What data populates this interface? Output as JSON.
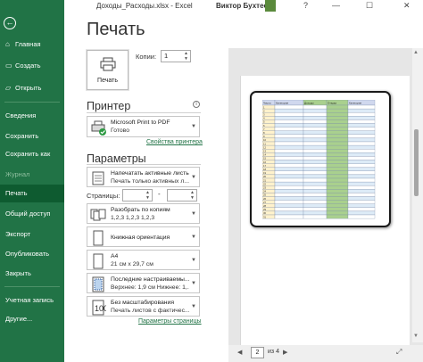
{
  "titlebar": {
    "doc_name": "Доходы_Расходы.xlsx  -  Excel",
    "user_name": "Виктор Бухтеев",
    "minimize": "—",
    "maximize": "☐",
    "close": "✕",
    "help": "?"
  },
  "sidebar": {
    "back_icon": "←",
    "items": [
      {
        "label": "Главная",
        "icon": "⌂"
      },
      {
        "label": "Создать",
        "icon": "▭"
      },
      {
        "label": "Открыть",
        "icon": "▱"
      },
      {
        "label": "Сведения"
      },
      {
        "label": "Сохранить"
      },
      {
        "label": "Сохранить как"
      },
      {
        "label": "Журнал"
      },
      {
        "label": "Печать"
      },
      {
        "label": "Общий доступ"
      },
      {
        "label": "Экспорт"
      },
      {
        "label": "Опубликовать"
      },
      {
        "label": "Закрыть"
      },
      {
        "label": "Учетная запись"
      },
      {
        "label": "Другие..."
      }
    ],
    "active_index": 7,
    "disabled_index": 6
  },
  "main": {
    "heading": "Печать",
    "print_button_label": "Печать",
    "copies_label": "Копии:",
    "copies_value": "1",
    "printer_title": "Принтер",
    "printer_name": "Microsoft Print to PDF",
    "printer_status": "Готово",
    "printer_properties_link": "Свойства принтера",
    "params_title": "Параметры",
    "settings": [
      {
        "l1": "Напечатать активные листы",
        "l2": "Печать только активных л..."
      },
      {
        "l1": "Разобрать по копиям",
        "l2": "1,2,3     1,2,3     1,2,3"
      },
      {
        "l1": "Книжная ориентация",
        "l2": ""
      },
      {
        "l1": "A4",
        "l2": "21 см x 29,7 см"
      },
      {
        "l1": "Последние настраиваемы...",
        "l2": "Верхнее: 1,9 см Нижнее: 1,..."
      },
      {
        "l1": "Без масштабирования",
        "l2": "Печать листов с фактичес..."
      }
    ],
    "pages_label": "Страницы:",
    "pages_dash": "-",
    "page_setup_link": "Параметры страницы"
  },
  "preview": {
    "headers": [
      "Число",
      "Категория",
      "Доходы",
      "Откуда",
      "Категория"
    ],
    "row_numbers": [
      "1",
      "2",
      "3",
      "4",
      "5",
      "6",
      "7",
      "8",
      "9",
      "10",
      "11",
      "12",
      "13",
      "14",
      "15",
      "16",
      "17",
      "18",
      "19",
      "20",
      "21",
      "22",
      "23",
      "24",
      "25",
      "26",
      "27",
      "28",
      "29",
      "30",
      "31"
    ],
    "current_page": "2",
    "of_pages": "из 4",
    "prev": "◀",
    "next": "▶",
    "fit_icon": "⤢"
  },
  "colors": {
    "sidebar": "#217346",
    "sidebar_active": "#0e5b30",
    "header_fill": "#d0d8ee",
    "green_col": "#a9d08e",
    "blue_row": "#ddebf7",
    "yellow_col": "#fff2cc"
  }
}
